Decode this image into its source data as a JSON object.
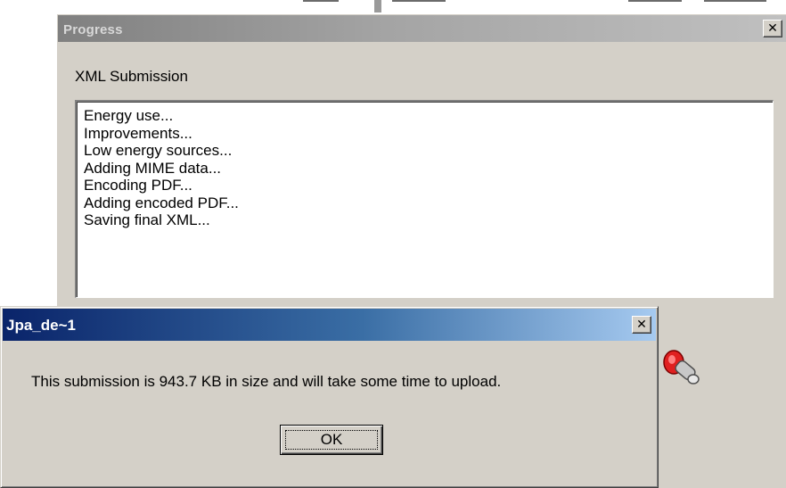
{
  "progress_window": {
    "title": "Progress",
    "close_label": "✕",
    "section_label": "XML Submission",
    "log_lines": [
      "Energy use...",
      "Improvements...",
      "Low energy sources...",
      "Adding MIME data...",
      "Encoding PDF...",
      "Adding encoded PDF...",
      "Saving final XML..."
    ]
  },
  "message_box": {
    "title": "Jpa_de~1",
    "close_label": "✕",
    "message": "This submission is 943.7 KB in size and will take some time to upload.",
    "ok_label": "OK"
  },
  "colors": {
    "dialog_face": "#d4d0c8",
    "active_title_start": "#0a246a",
    "active_title_end": "#a6caf0",
    "inactive_title_start": "#808080",
    "inactive_title_end": "#c0c0c0"
  }
}
